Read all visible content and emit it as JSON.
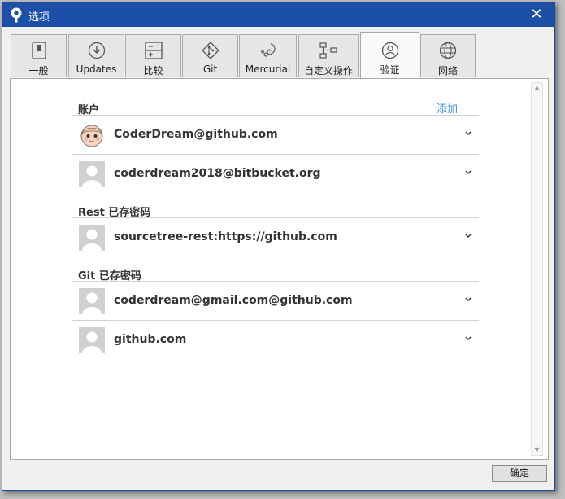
{
  "window": {
    "title": "选项"
  },
  "tabs": [
    {
      "label": "一般",
      "icon": "switch-icon"
    },
    {
      "label": "Updates",
      "icon": "download-circle-icon"
    },
    {
      "label": "比较",
      "icon": "diff-icon"
    },
    {
      "label": "Git",
      "icon": "git-icon"
    },
    {
      "label": "Mercurial",
      "icon": "mercurial-icon"
    },
    {
      "label": "自定义操作",
      "icon": "custom-actions-icon"
    },
    {
      "label": "验证",
      "icon": "user-circle-icon",
      "active": true
    },
    {
      "label": "网络",
      "icon": "globe-icon"
    }
  ],
  "accounts": {
    "title": "账户",
    "add_label": "添加",
    "items": [
      {
        "name": "CoderDream@github.com",
        "avatar": "cartoon-avatar"
      },
      {
        "name": "coderdream2018@bitbucket.org",
        "avatar": "default-avatar"
      }
    ]
  },
  "rest": {
    "title": "Rest 已存密码",
    "items": [
      {
        "name": "sourcetree-rest:https://github.com"
      }
    ]
  },
  "git": {
    "title": "Git 已存密码",
    "items": [
      {
        "name": "coderdream@gmail.com@github.com"
      },
      {
        "name": "github.com"
      }
    ]
  },
  "footer": {
    "ok_label": "确定"
  },
  "colors": {
    "titlebar": "#1b4fa8",
    "link": "#3b8ce0"
  }
}
